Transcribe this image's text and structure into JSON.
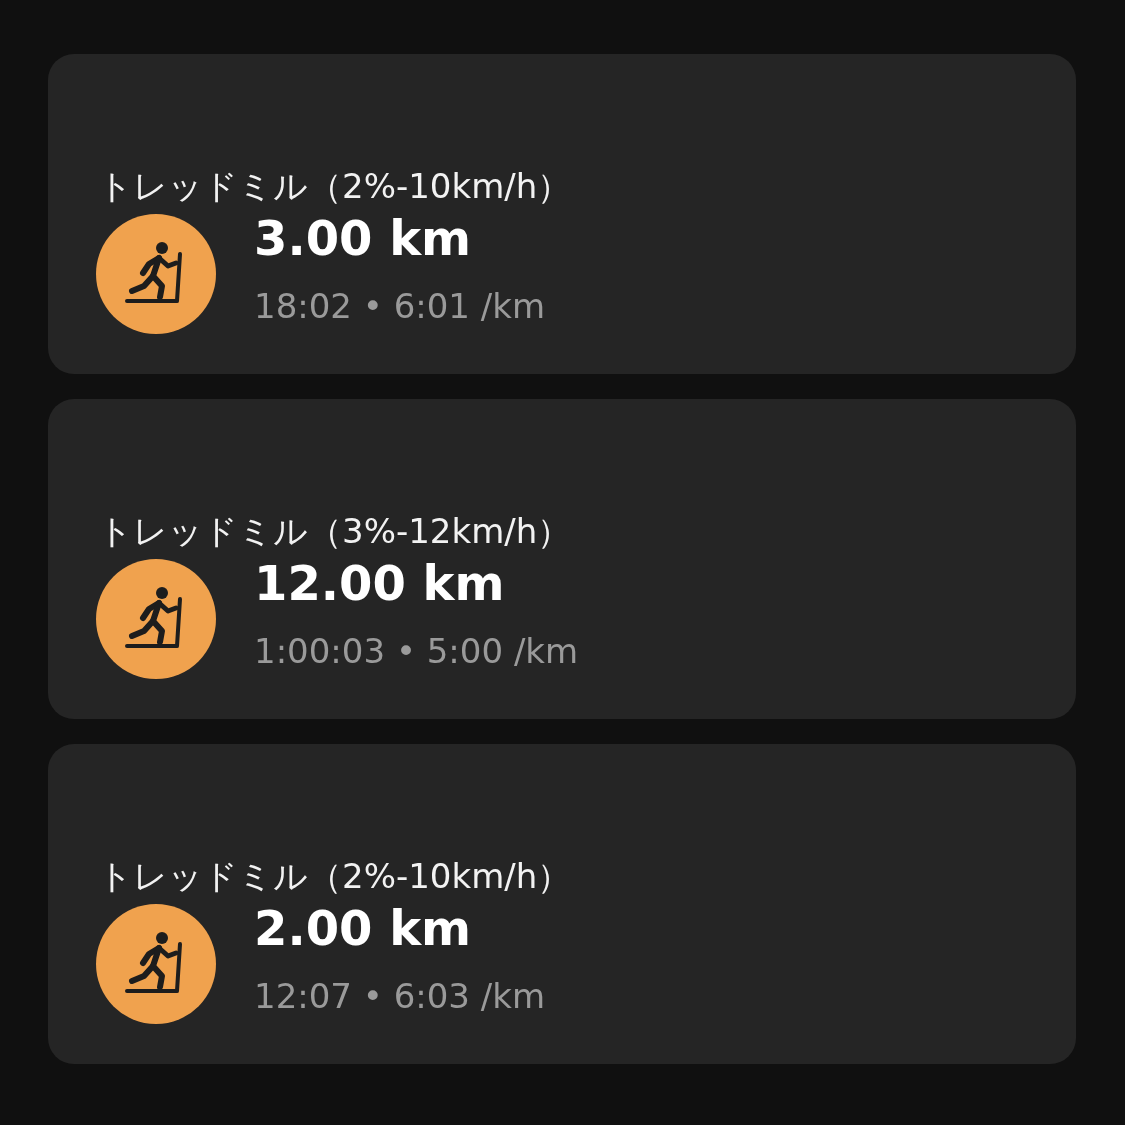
{
  "workouts": [
    {
      "title": "トレッドミル（2%-10km/h）",
      "distance": "3.00 km",
      "meta": "18:02 • 6:01 /km"
    },
    {
      "title": "トレッドミル（3%-12km/h）",
      "distance": "12.00 km",
      "meta": "1:00:03 • 5:00 /km"
    },
    {
      "title": "トレッドミル（2%-10km/h）",
      "distance": "2.00 km",
      "meta": "12:07 • 6:03 /km"
    }
  ]
}
